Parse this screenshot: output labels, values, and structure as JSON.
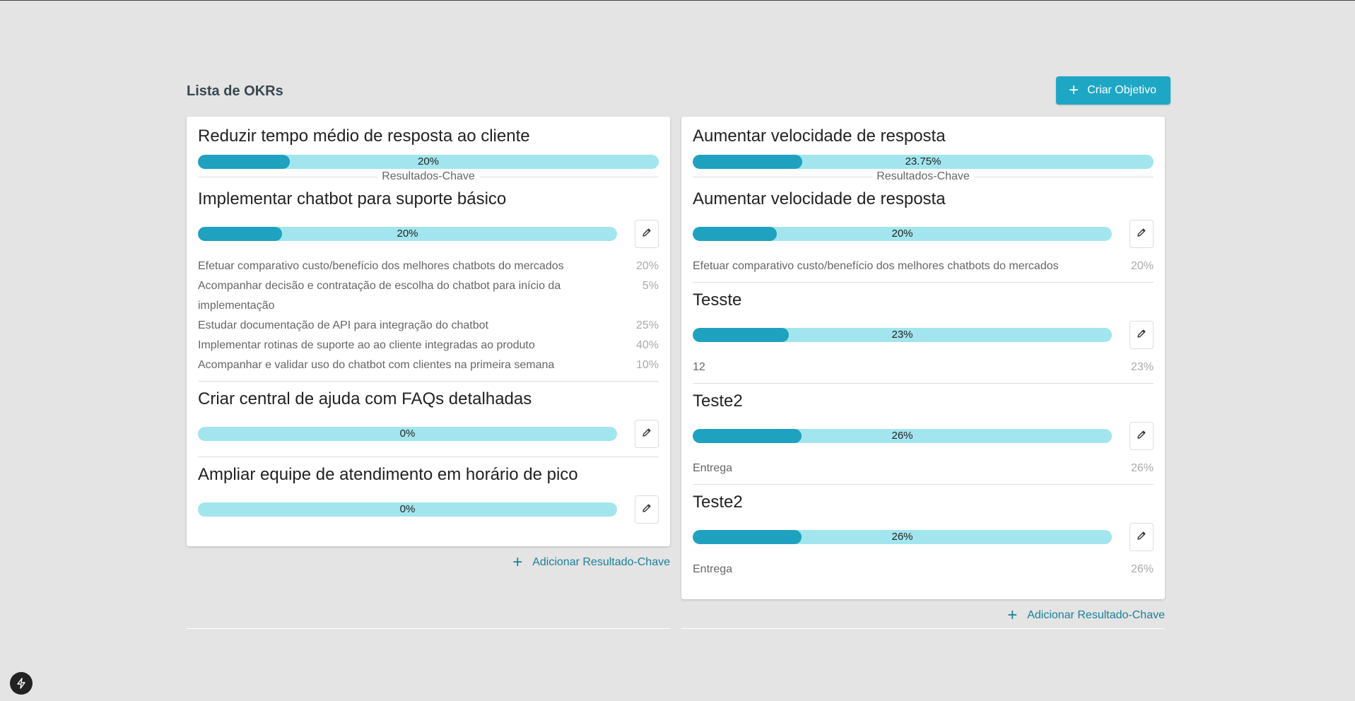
{
  "page_title": "Lista de OKRs",
  "create_button": "Criar Objetivo",
  "key_results_label": "Resultados-Chave",
  "add_kr_label": "Adicionar Resultado-Chave",
  "colors": {
    "accent": "#1ea7c5",
    "bar_track": "#a2e5ee",
    "bar_fill": "#1ea2bf",
    "link": "#1a7f9a"
  },
  "objectives": [
    {
      "title": "Reduzir tempo médio de resposta ao cliente",
      "progress": 20,
      "progress_label": "20%",
      "key_results": [
        {
          "title": "Implementar chatbot para suporte básico",
          "progress": 20,
          "progress_label": "20%",
          "tasks": [
            {
              "name": "Efetuar comparativo custo/benefício dos melhores chatbots do mercados",
              "pct": "20%"
            },
            {
              "name": "Acompanhar decisão e contratação de escolha do chatbot para início da implementação",
              "pct": "5%"
            },
            {
              "name": "Estudar documentação de API para integração do chatbot",
              "pct": "25%"
            },
            {
              "name": "Implementar rotinas de suporte ao ao cliente integradas ao produto",
              "pct": "40%"
            },
            {
              "name": "Acompanhar e validar uso do chatbot com clientes na primeira semana",
              "pct": "10%"
            }
          ]
        },
        {
          "title": "Criar central de ajuda com FAQs detalhadas",
          "progress": 0,
          "progress_label": "0%",
          "tasks": []
        },
        {
          "title": "Ampliar equipe de atendimento em horário de pico",
          "progress": 0,
          "progress_label": "0%",
          "tasks": []
        }
      ]
    },
    {
      "title": "Aumentar velocidade de resposta",
      "progress": 23.75,
      "progress_label": "23.75%",
      "key_results": [
        {
          "title": "Aumentar velocidade de resposta",
          "progress": 20,
          "progress_label": "20%",
          "tasks": [
            {
              "name": "Efetuar comparativo custo/benefício dos melhores chatbots do mercados",
              "pct": "20%"
            }
          ]
        },
        {
          "title": "Tesste",
          "progress": 23,
          "progress_label": "23%",
          "tasks": [
            {
              "name": "12",
              "pct": "23%"
            }
          ]
        },
        {
          "title": "Teste2",
          "progress": 26,
          "progress_label": "26%",
          "tasks": [
            {
              "name": "Entrega",
              "pct": "26%"
            }
          ]
        },
        {
          "title": "Teste2",
          "progress": 26,
          "progress_label": "26%",
          "tasks": [
            {
              "name": "Entrega",
              "pct": "26%"
            }
          ]
        }
      ]
    }
  ]
}
